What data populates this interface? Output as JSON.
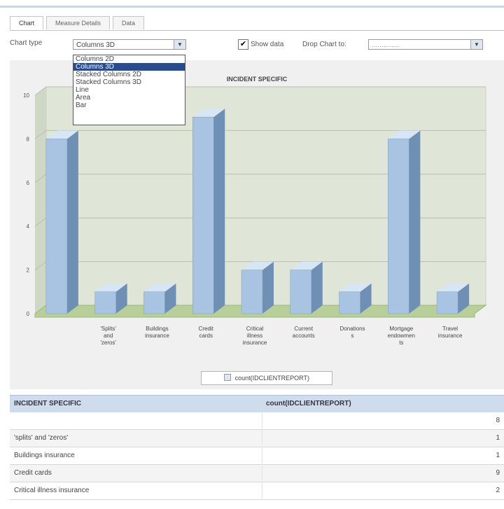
{
  "tabs": [
    "Chart",
    "Measure Details",
    "Data"
  ],
  "options": {
    "chart_type_label": "Chart type",
    "chart_type_value": "Columns 3D",
    "chart_type_options": [
      "Columns 2D",
      "Columns 3D",
      "Stacked Columns 2D",
      "Stacked Columns 3D",
      "Line",
      "Area",
      "Bar"
    ],
    "selected_option_index": 1,
    "show_data_label": "Show data",
    "show_data_checked": true,
    "show_data_mark": "✔",
    "group_chart_label": "Drop Chart to:",
    "group_chart_value": "..............",
    "dropdown_arrow": "▼"
  },
  "chart_data": {
    "type": "bar",
    "title": "INCIDENT SPECIFIC",
    "categories": [
      "",
      "'Splits' and 'zeros'",
      "Buildings insurance",
      "Credit cards",
      "Critical illness insurance",
      "Current accounts",
      "Donations",
      "Mortgage endowments",
      "Travel insurance"
    ],
    "category_labels": [
      [],
      [
        "'Splits'",
        "and",
        "'zeros'"
      ],
      [
        "Buildings",
        "insurance"
      ],
      [
        "Credit",
        "cards"
      ],
      [
        "Critical",
        "illness",
        "insurance"
      ],
      [
        "Current",
        "accounts"
      ],
      [
        "Donations",
        "s"
      ],
      [
        "Mortgage",
        "endowmen",
        "ts"
      ],
      [
        "Travel",
        "insurance"
      ]
    ],
    "series": [
      {
        "name": "count(IDCLIENTREPORT)",
        "values": [
          8,
          1,
          1,
          9,
          2,
          2,
          1,
          8,
          1
        ]
      }
    ],
    "ylim": [
      0,
      10
    ],
    "yticks": [
      0,
      2,
      4,
      6,
      8,
      10
    ],
    "legend_label": "count(IDCLIENTREPORT)",
    "colors": {
      "bar_front": "#a9c4e3",
      "bar_side": "#6f8fb5",
      "bar_top": "#d7e6f5",
      "floor": "#b9cf9a",
      "wall": "#dfe5d7"
    }
  },
  "table": {
    "headers": [
      "INCIDENT SPECIFIC",
      "count(IDCLIENTREPORT)"
    ],
    "rows": [
      {
        "label": "",
        "value": "8"
      },
      {
        "label": "'splits' and 'zeros'",
        "value": "1"
      },
      {
        "label": "Buildings insurance",
        "value": "1"
      },
      {
        "label": "Credit cards",
        "value": "9"
      },
      {
        "label": "Critical illness insurance",
        "value": "2"
      }
    ]
  }
}
